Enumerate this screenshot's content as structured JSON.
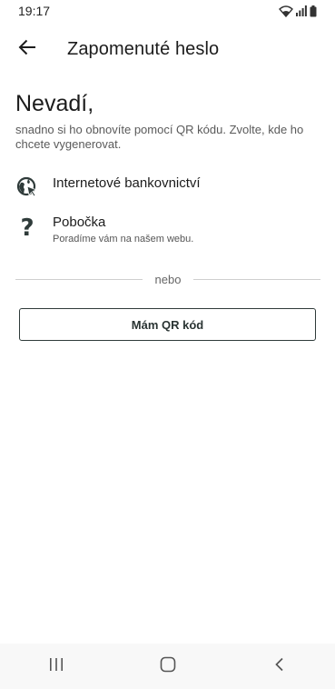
{
  "status_bar": {
    "time": "19:17",
    "icons": [
      "wifi-icon",
      "signal-icon",
      "battery-icon"
    ]
  },
  "app_bar": {
    "back_icon": "arrow-left-icon",
    "title": "Zapomenuté heslo"
  },
  "content": {
    "heading": "Nevadí,",
    "subheading": "snadno si ho obnovíte pomocí QR kódu. Zvolte, kde ho chcete vygenerovat.",
    "options": [
      {
        "icon": "internet-banking-icon",
        "title": "Internetové bankovnictví",
        "subtitle": ""
      },
      {
        "icon": "question-icon",
        "title": "Pobočka",
        "subtitle": "Poradíme vám na našem webu."
      }
    ],
    "divider_label": "nebo",
    "qr_button_label": "Mám QR kód"
  },
  "nav_bar": {
    "icons": [
      "recent-apps-icon",
      "home-icon",
      "back-nav-icon"
    ]
  },
  "colors": {
    "accent": "#2f3b3a",
    "text": "#1c1c1c",
    "muted": "#5a5a5a",
    "nav_bg": "#f8f8f8"
  }
}
